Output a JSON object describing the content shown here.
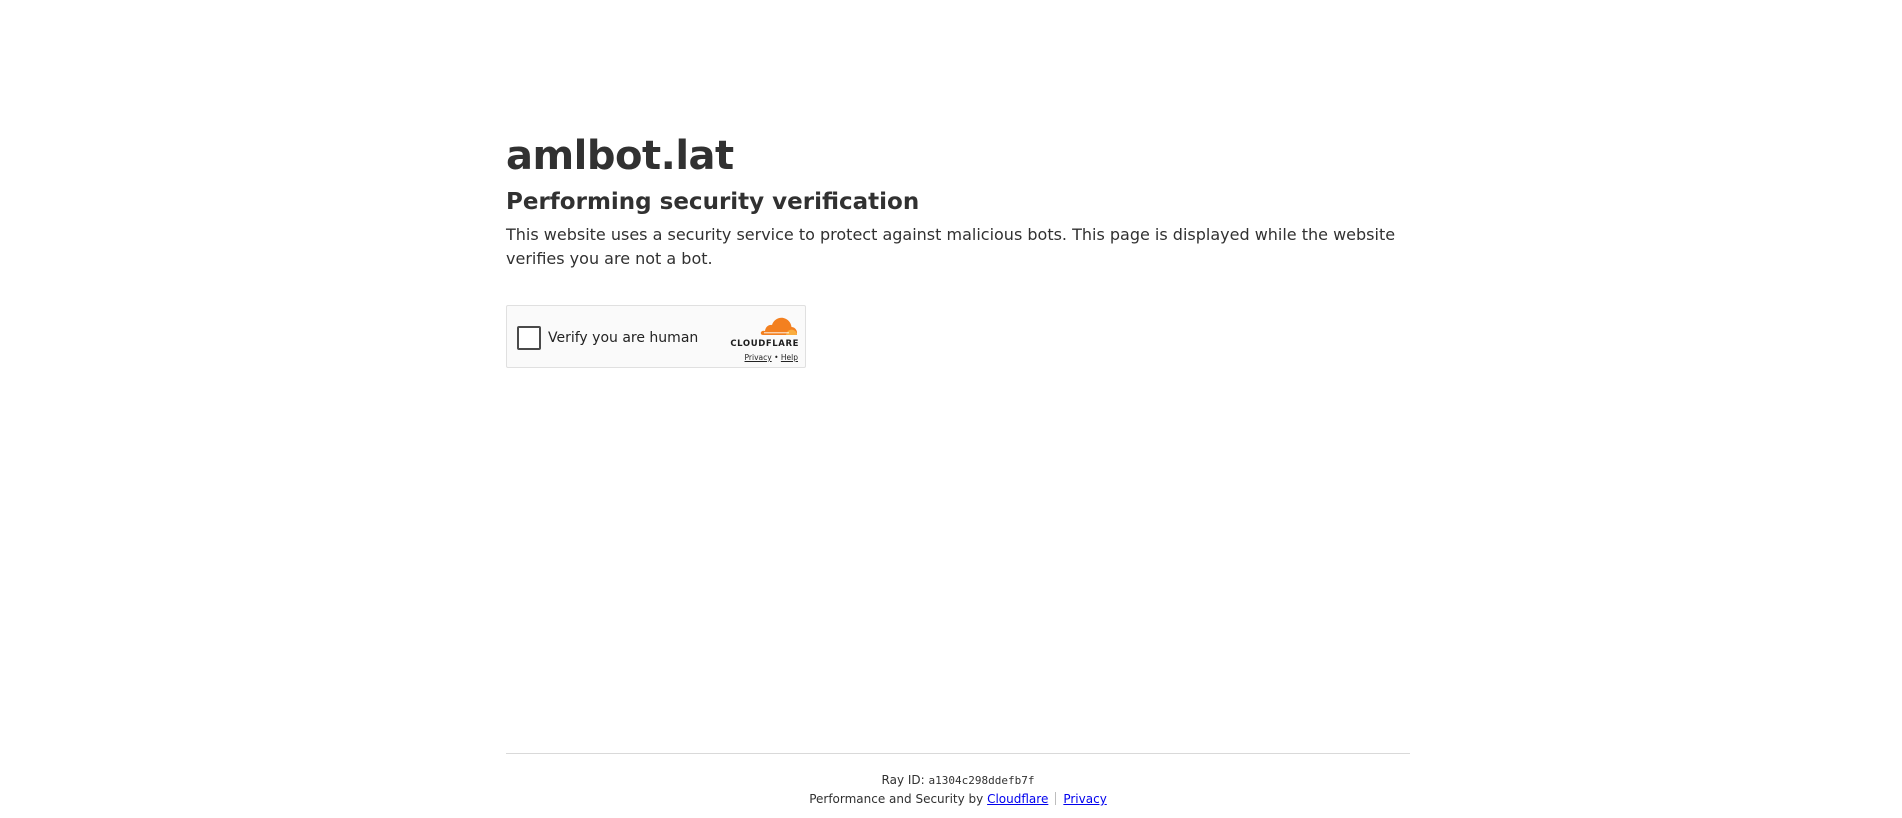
{
  "site": {
    "name": "amlbot.lat"
  },
  "main": {
    "heading": "Performing security verification",
    "description": "This website uses a security service to protect against malicious bots. This page is displayed while the website verifies you are not a bot."
  },
  "widget": {
    "checkbox_label": "Verify you are human",
    "brand": "CLOUDFLARE",
    "privacy_link": "Privacy",
    "links_separator": "•",
    "help_link": "Help",
    "brand_color": "#f38020",
    "cloud_icon": "cloudflare-logo-icon"
  },
  "footer": {
    "ray_label": "Ray ID:",
    "ray_id": "a1304c298ddefb7f",
    "performance_text": "Performance and Security by",
    "cloudflare_link": "Cloudflare",
    "privacy_link": "Privacy"
  }
}
